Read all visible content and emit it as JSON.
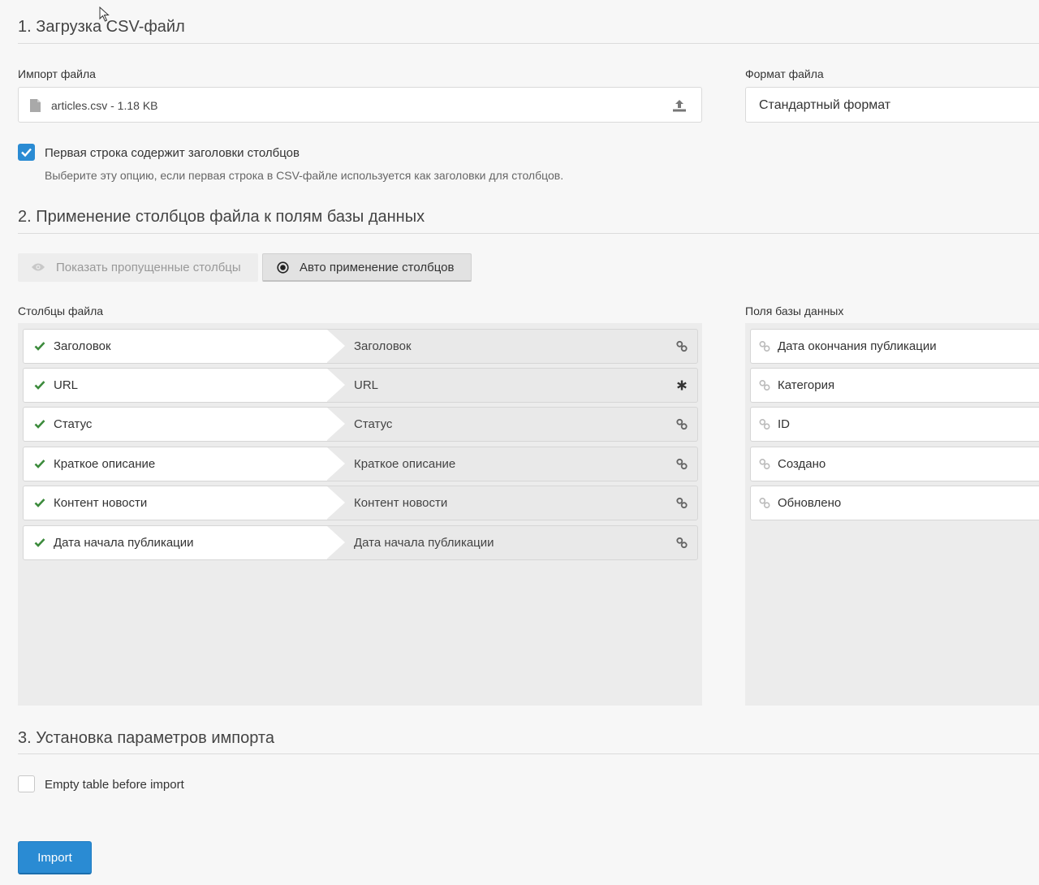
{
  "section1": {
    "title": "1. Загрузка CSV-файл",
    "import_label": "Импорт файла",
    "file_name": "articles.csv - 1.18 KB",
    "format_label": "Формат файла",
    "format_value": "Стандартный формат",
    "header_checkbox_label": "Первая строка содержит заголовки столбцов",
    "header_checkbox_hint": "Выберите эту опцию, если первая строка в CSV-файле используется как заголовки для столбцов.",
    "header_checkbox_checked": true
  },
  "section2": {
    "title": "2. Применение столбцов файла к полям базы данных",
    "show_skipped_label": "Показать пропущенные столбцы",
    "auto_map_label": "Авто применение столбцов",
    "file_columns_label": "Столбцы файла",
    "db_fields_label": "Поля базы данных",
    "mappings": [
      {
        "column": "Заголовок",
        "field": "Заголовок",
        "icon": "link-icon"
      },
      {
        "column": "URL",
        "field": "URL",
        "icon": "asterisk-icon"
      },
      {
        "column": "Статус",
        "field": "Статус",
        "icon": "link-icon"
      },
      {
        "column": "Краткое описание",
        "field": "Краткое описание",
        "icon": "link-icon"
      },
      {
        "column": "Контент новости",
        "field": "Контент новости",
        "icon": "link-icon"
      },
      {
        "column": "Дата начала публикации",
        "field": "Дата начала публикации",
        "icon": "link-icon"
      }
    ],
    "db_fields": [
      "Дата окончания публикации",
      "Категория",
      "ID",
      "Создано",
      "Обновлено"
    ]
  },
  "section3": {
    "title": "3. Установка параметров импорта",
    "empty_table_label": "Empty table before import",
    "empty_table_checked": false
  },
  "import_button_label": "Import",
  "colors": {
    "primary": "#2a8bd3",
    "check_green": "#3c8b3c",
    "panel_bg": "#ececec"
  }
}
